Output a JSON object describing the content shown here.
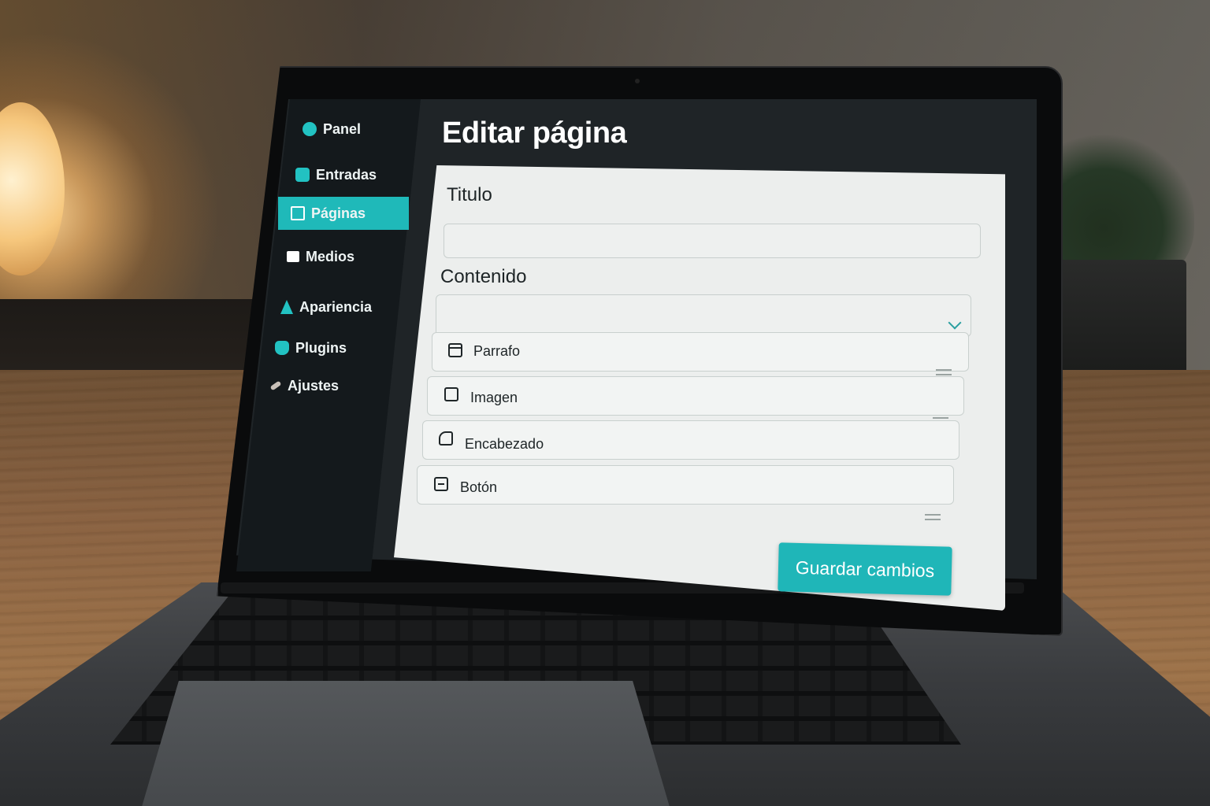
{
  "sidebar": {
    "items": [
      {
        "label": "Panel",
        "icon": "circle-info-icon",
        "active": false
      },
      {
        "label": "Entradas",
        "icon": "post-icon",
        "active": false
      },
      {
        "label": "Páginas",
        "icon": "page-icon",
        "active": true
      },
      {
        "label": "Medios",
        "icon": "media-icon",
        "active": false
      },
      {
        "label": "Apariencia",
        "icon": "appearance-icon",
        "active": false
      },
      {
        "label": "Plugins",
        "icon": "plugin-icon",
        "active": false
      },
      {
        "label": "Ajustes",
        "icon": "settings-icon",
        "active": false
      }
    ]
  },
  "main": {
    "title": "Editar página",
    "title_label": "Titulo",
    "title_value": "",
    "content_label": "Contenido",
    "content_select_value": "",
    "blocks": [
      {
        "label": "Parrafo",
        "icon": "paragraph-block-icon"
      },
      {
        "label": "Imagen",
        "icon": "image-block-icon"
      },
      {
        "label": "Encabezado",
        "icon": "heading-block-icon"
      },
      {
        "label": "Botón",
        "icon": "button-block-icon"
      }
    ],
    "save_label": "Guardar cambios"
  },
  "colors": {
    "accent": "#1fb9b9",
    "sidebar_bg": "#14191c",
    "panel_bg": "#1f2427",
    "card_bg": "#eceeed"
  }
}
